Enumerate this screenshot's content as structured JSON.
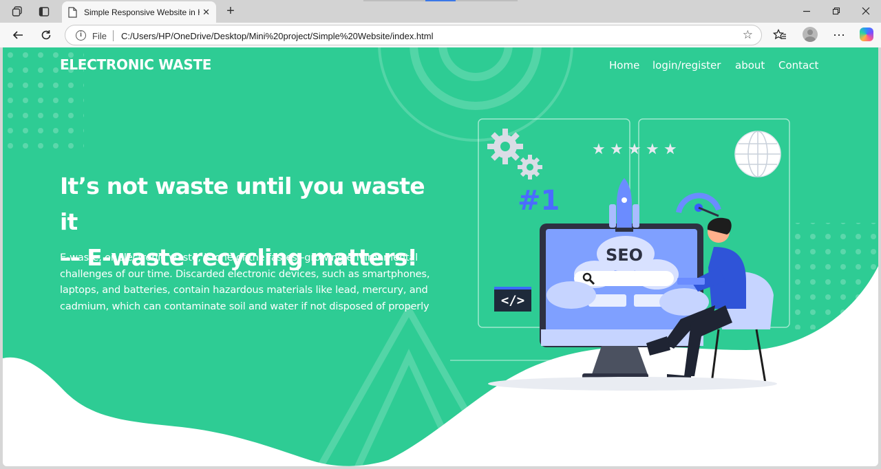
{
  "browser": {
    "tab_title": "Simple Responsive Website in HTML",
    "new_tab_symbol": "+",
    "address": {
      "scheme_label": "File",
      "url": "C:/Users/HP/OneDrive/Desktop/Mini%20project/Simple%20Website/index.html"
    }
  },
  "site": {
    "brand": "ELECTRONIC WASTE",
    "nav": [
      "Home",
      "login/register",
      "about",
      "Contact"
    ],
    "headline_line1": "It’s not waste until you waste it",
    "headline_line2": "–- E-waste recycling matters!",
    "description": "E-waste, or electronic waste, is one of the fastest-growing environmental challenges of our time. Discarded electronic devices, such as smartphones, laptops, and batteries, contain hazardous materials like lead, mercury, and cadmium, which can contaminate soil and water if not disposed of properly",
    "illustration": {
      "rank_text": "#1",
      "seo_text": "SEO",
      "code_text": "</>",
      "stars": 5
    }
  },
  "colors": {
    "hero_green": "#2ecc94",
    "accent_blue": "#4b6bff",
    "light_blue": "#c6d4ff"
  }
}
